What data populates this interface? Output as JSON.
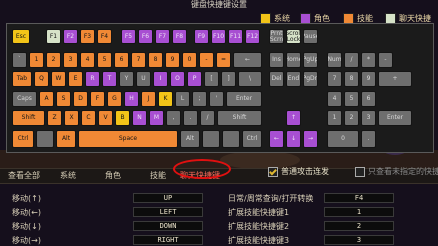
{
  "title": "键盘快捷键设置",
  "legend": [
    {
      "id": "system",
      "label": "系统",
      "color": "#f2c418"
    },
    {
      "id": "role",
      "label": "角色",
      "color": "#a84fd2"
    },
    {
      "id": "skill",
      "label": "技能",
      "color": "#f08935"
    },
    {
      "id": "chat",
      "label": "聊天快捷",
      "color": "#d6e2c8"
    }
  ],
  "keyboard_rows": [
    [
      {
        "l": "Esc",
        "c": "sys"
      },
      {
        "l": "F1",
        "c": "chat"
      },
      {
        "l": "F2",
        "c": "role"
      },
      {
        "l": "F3",
        "c": "skill"
      },
      {
        "l": "F4",
        "c": "skill"
      },
      {
        "l": "F5",
        "c": "role"
      },
      {
        "l": "F6",
        "c": "role"
      },
      {
        "l": "F7",
        "c": "role"
      },
      {
        "l": "F8",
        "c": "role"
      },
      {
        "l": "F9",
        "c": "role"
      },
      {
        "l": "F10",
        "c": "role"
      },
      {
        "l": "F11",
        "c": "role"
      },
      {
        "l": "F12",
        "c": "role"
      },
      {
        "l": "Prnt Scrn",
        "c": "def"
      },
      {
        "l": "Scroll Lock",
        "c": "chat"
      },
      {
        "l": "Pause",
        "c": "def"
      }
    ],
    [
      {
        "l": "`",
        "c": "def"
      },
      {
        "l": "1",
        "c": "skill"
      },
      {
        "l": "2",
        "c": "skill"
      },
      {
        "l": "3",
        "c": "skill"
      },
      {
        "l": "4",
        "c": "skill"
      },
      {
        "l": "5",
        "c": "skill"
      },
      {
        "l": "6",
        "c": "skill"
      },
      {
        "l": "7",
        "c": "skill"
      },
      {
        "l": "8",
        "c": "skill"
      },
      {
        "l": "9",
        "c": "skill"
      },
      {
        "l": "0",
        "c": "skill"
      },
      {
        "l": "-",
        "c": "skill"
      },
      {
        "l": "=",
        "c": "skill"
      },
      {
        "l": "←",
        "c": "def"
      },
      {
        "l": "Ins",
        "c": "def"
      },
      {
        "l": "Home",
        "c": "def"
      },
      {
        "l": "PgUp",
        "c": "def"
      },
      {
        "l": "Num",
        "c": "def"
      },
      {
        "l": "/",
        "c": "def"
      },
      {
        "l": "*",
        "c": "def"
      },
      {
        "l": "-",
        "c": "def"
      }
    ],
    [
      {
        "l": "Tab",
        "c": "skill"
      },
      {
        "l": "Q",
        "c": "skill"
      },
      {
        "l": "W",
        "c": "skill"
      },
      {
        "l": "E",
        "c": "skill"
      },
      {
        "l": "R",
        "c": "role"
      },
      {
        "l": "T",
        "c": "role"
      },
      {
        "l": "Y",
        "c": "def"
      },
      {
        "l": "U",
        "c": "def"
      },
      {
        "l": "I",
        "c": "role"
      },
      {
        "l": "O",
        "c": "role"
      },
      {
        "l": "P",
        "c": "role"
      },
      {
        "l": "[",
        "c": "def"
      },
      {
        "l": "]",
        "c": "def"
      },
      {
        "l": "\\",
        "c": "def"
      },
      {
        "l": "Del",
        "c": "def"
      },
      {
        "l": "End",
        "c": "def"
      },
      {
        "l": "PgDn",
        "c": "def"
      },
      {
        "l": "7",
        "c": "def"
      },
      {
        "l": "8",
        "c": "def"
      },
      {
        "l": "9",
        "c": "def"
      },
      {
        "l": "+",
        "c": "def"
      }
    ],
    [
      {
        "l": "Caps",
        "c": "def"
      },
      {
        "l": "A",
        "c": "skill"
      },
      {
        "l": "S",
        "c": "skill"
      },
      {
        "l": "D",
        "c": "skill"
      },
      {
        "l": "F",
        "c": "skill"
      },
      {
        "l": "G",
        "c": "skill"
      },
      {
        "l": "H",
        "c": "role"
      },
      {
        "l": "J",
        "c": "skill"
      },
      {
        "l": "K",
        "c": "sys"
      },
      {
        "l": "L",
        "c": "def"
      },
      {
        "l": ";",
        "c": "def"
      },
      {
        "l": "'",
        "c": "def"
      },
      {
        "l": "Enter",
        "c": "def"
      },
      {
        "l": "4",
        "c": "def"
      },
      {
        "l": "5",
        "c": "def"
      },
      {
        "l": "6",
        "c": "def"
      }
    ],
    [
      {
        "l": "Shift",
        "c": "skill"
      },
      {
        "l": "Z",
        "c": "skill"
      },
      {
        "l": "X",
        "c": "skill"
      },
      {
        "l": "C",
        "c": "skill"
      },
      {
        "l": "V",
        "c": "skill"
      },
      {
        "l": "B",
        "c": "sys"
      },
      {
        "l": "N",
        "c": "role"
      },
      {
        "l": "M",
        "c": "role"
      },
      {
        "l": ",",
        "c": "def"
      },
      {
        "l": ".",
        "c": "def"
      },
      {
        "l": "/",
        "c": "def"
      },
      {
        "l": "Shift",
        "c": "def"
      },
      {
        "l": "↑",
        "c": "role"
      },
      {
        "l": "1",
        "c": "def"
      },
      {
        "l": "2",
        "c": "def"
      },
      {
        "l": "3",
        "c": "def"
      },
      {
        "l": "Enter",
        "c": "def"
      }
    ],
    [
      {
        "l": "Ctrl",
        "c": "skill"
      },
      {
        "l": "",
        "c": "def"
      },
      {
        "l": "Alt",
        "c": "skill"
      },
      {
        "l": "Space",
        "c": "skill"
      },
      {
        "l": "Alt",
        "c": "def"
      },
      {
        "l": "",
        "c": "def"
      },
      {
        "l": "",
        "c": "def"
      },
      {
        "l": "Ctrl",
        "c": "def"
      },
      {
        "l": "←",
        "c": "role"
      },
      {
        "l": "↓",
        "c": "role"
      },
      {
        "l": "→",
        "c": "role"
      },
      {
        "l": "0",
        "c": "def"
      },
      {
        "l": ".",
        "c": "def"
      }
    ]
  ],
  "tabs": [
    "查看全部",
    "系统",
    "角色",
    "技能",
    "聊天快捷键"
  ],
  "active_tab": 4,
  "options": [
    {
      "label": "普通攻击连发",
      "checked": true,
      "enabled": true
    },
    {
      "label": "只查看未指定的快捷",
      "checked": false,
      "enabled": false
    }
  ],
  "bindings_left": [
    {
      "label": "移动(↑)",
      "key": "UP"
    },
    {
      "label": "移动(←)",
      "key": "LEFT"
    },
    {
      "label": "移动(↓)",
      "key": "DOWN"
    },
    {
      "label": "移动(→)",
      "key": "RIGHT"
    }
  ],
  "bindings_right": [
    {
      "label": "日常/周常查询/打开转换",
      "key": "F4"
    },
    {
      "label": "扩展技能快捷键1",
      "key": "1"
    },
    {
      "label": "扩展技能快捷键2",
      "key": "2"
    },
    {
      "label": "扩展技能快捷键3",
      "key": "3"
    }
  ]
}
